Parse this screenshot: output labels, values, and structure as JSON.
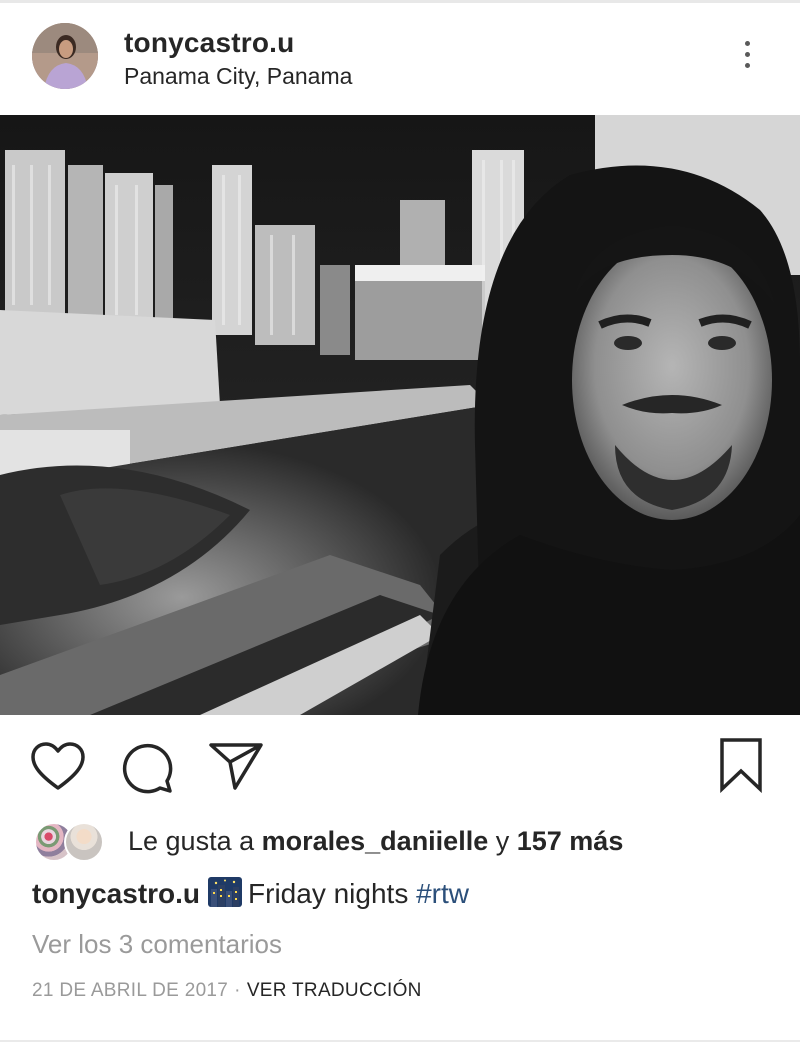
{
  "post": {
    "username": "tonycastro.u",
    "location": "Panama City, Panama",
    "likes": {
      "prefix": "Le gusta a ",
      "liker": "morales_daniielle",
      "connector": " y ",
      "more": "157 más"
    },
    "caption": {
      "username": "tonycastro.u",
      "emoji": "night-city-emoji",
      "text": "Friday nights ",
      "hashtag": "#rtw"
    },
    "view_comments": "Ver los 3 comentarios",
    "date": "21 DE ABRIL DE 2017",
    "separator": "·",
    "translate": "VER TRADUCCIÓN"
  },
  "icons": {
    "like": "heart-icon",
    "comment": "comment-bubble-icon",
    "share": "paper-plane-icon",
    "save": "bookmark-icon",
    "more": "more-options-icon"
  },
  "colors": {
    "text": "#262626",
    "muted": "#9a9a9a",
    "hashtag": "#2b4f7a"
  }
}
